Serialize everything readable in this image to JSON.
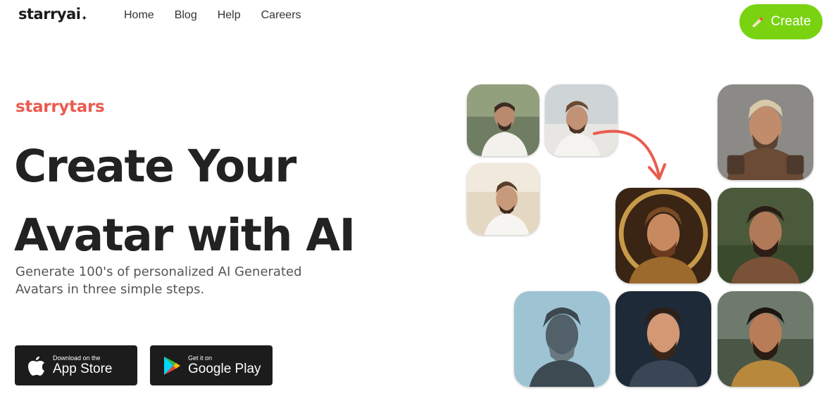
{
  "header": {
    "logo": "starryai",
    "nav": [
      "Home",
      "Blog",
      "Help",
      "Careers"
    ],
    "create_label": "Create"
  },
  "hero": {
    "brand": "starrytars",
    "headline": "Create Your Avatar with AI",
    "subtitle": "Generate 100's of personalized AI Generated Avatars in three simple steps."
  },
  "stores": {
    "apple": {
      "small": "Download on the",
      "big": "App Store",
      "icon": "apple-icon"
    },
    "google": {
      "small": "Get it on",
      "big": "Google Play",
      "icon": "google-play-icon"
    }
  },
  "colors": {
    "accent": "#79d311",
    "brand": "#ea5b4f",
    "store_bg": "#1c1c1c"
  }
}
